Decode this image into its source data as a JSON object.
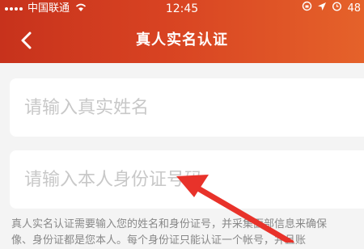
{
  "status_bar": {
    "carrier": "中国联通",
    "time": "12:45",
    "battery": "48"
  },
  "nav": {
    "title": "真人实名认证"
  },
  "form": {
    "name_placeholder": "请输入真实姓名",
    "id_placeholder": "请输入本人身份证号码"
  },
  "notice": {
    "line1": "真人实名认证需要输入您的姓名和身份证号，并采集面部信息来确保",
    "line2": "像、身份证都是您本人。每个身份证只能认证一个帐号，并且账"
  },
  "colors": {
    "header_start": "#c7321c",
    "header_end": "#e5622a",
    "annotation_arrow": "#e8322a"
  }
}
